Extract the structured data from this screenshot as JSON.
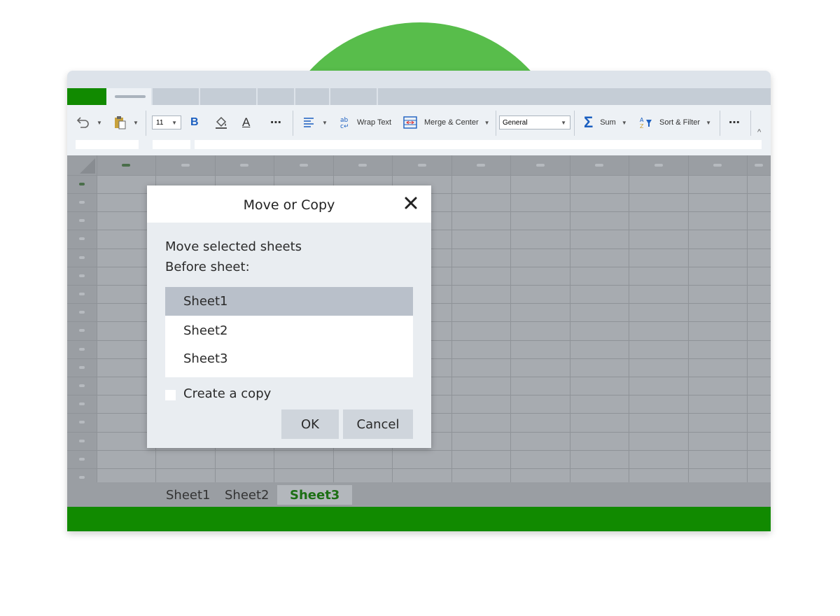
{
  "toolbar": {
    "font_size": "11",
    "bold_label": "B",
    "font_color_label": "A",
    "more_label": "⋯",
    "wrap_text_label": "Wrap Text",
    "merge_center_label": "Merge & Center",
    "number_format": "General",
    "sum_label": "Sum",
    "sort_filter_label": "Sort & Filter",
    "collapse_label": "^"
  },
  "dialog": {
    "title": "Move or Copy",
    "prompt_line1": "Move selected sheets",
    "prompt_line2": "Before sheet:",
    "sheets": [
      "Sheet1",
      "Sheet2",
      "Sheet3"
    ],
    "selected_index": 0,
    "create_copy_label": "Create a copy",
    "create_copy_checked": false,
    "ok_label": "OK",
    "cancel_label": "Cancel"
  },
  "sheet_tabs": {
    "tabs": [
      "Sheet1",
      "Sheet2",
      "Sheet3"
    ],
    "active": "Sheet3"
  },
  "colors": {
    "accent_green": "#118a00",
    "arc_green": "#58bd4b",
    "active_tab_text": "#1d6f14"
  }
}
